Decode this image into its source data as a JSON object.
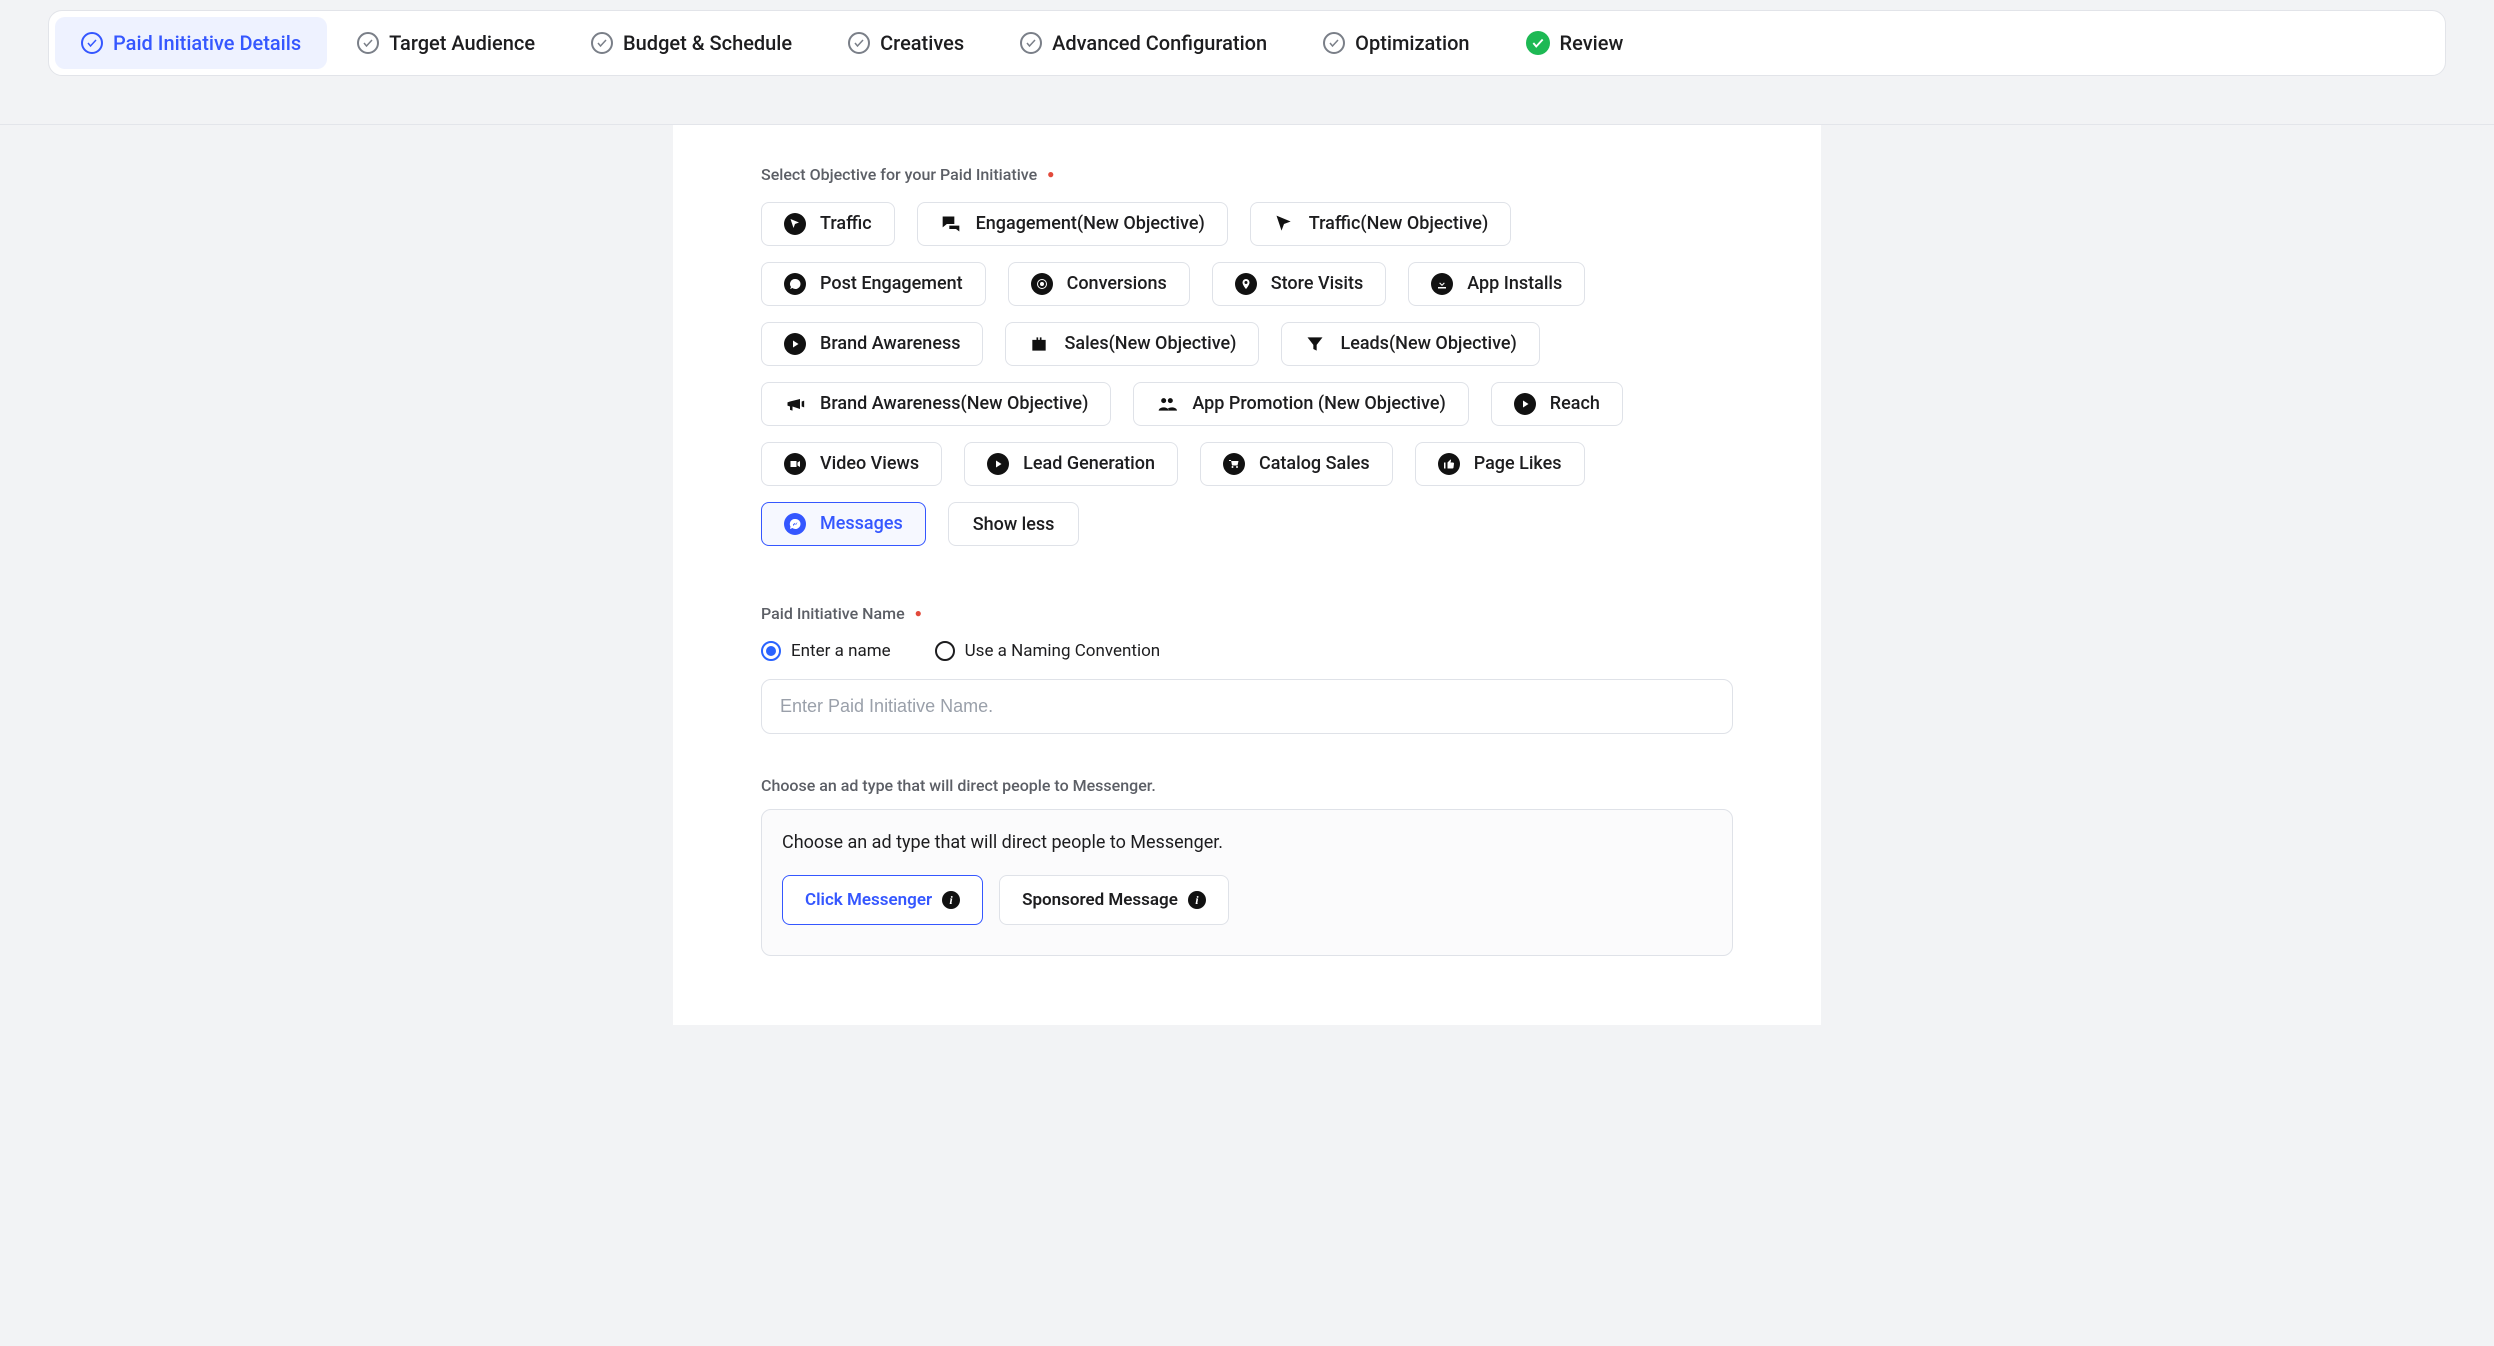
{
  "stepper": {
    "tabs": [
      {
        "label": "Paid Initiative Details",
        "state": "active"
      },
      {
        "label": "Target Audience",
        "state": "pending"
      },
      {
        "label": "Budget & Schedule",
        "state": "pending"
      },
      {
        "label": "Creatives",
        "state": "pending"
      },
      {
        "label": "Advanced Configuration",
        "state": "pending"
      },
      {
        "label": "Optimization",
        "state": "pending"
      },
      {
        "label": "Review",
        "state": "done"
      }
    ]
  },
  "objective": {
    "section_label": "Select Objective for your Paid Initiative",
    "chips": [
      {
        "label": "Traffic",
        "icon": "cursor-circle"
      },
      {
        "label": "Engagement(New Objective)",
        "icon": "chat-bare"
      },
      {
        "label": "Traffic(New Objective)",
        "icon": "cursor-bare"
      },
      {
        "label": "Post Engagement",
        "icon": "speech-circle"
      },
      {
        "label": "Conversions",
        "icon": "target-circle"
      },
      {
        "label": "Store Visits",
        "icon": "pin-circle"
      },
      {
        "label": "App Installs",
        "icon": "download-circle"
      },
      {
        "label": "Brand Awareness",
        "icon": "play-circle"
      },
      {
        "label": "Sales(New Objective)",
        "icon": "briefcase-bare"
      },
      {
        "label": "Leads(New Objective)",
        "icon": "funnel-bare"
      },
      {
        "label": "Brand Awareness(New Objective)",
        "icon": "megaphone-bare"
      },
      {
        "label": "App Promotion (New Objective)",
        "icon": "people-bare"
      },
      {
        "label": "Reach",
        "icon": "play-circle"
      },
      {
        "label": "Video Views",
        "icon": "video-circle"
      },
      {
        "label": "Lead Generation",
        "icon": "play-circle"
      },
      {
        "label": "Catalog Sales",
        "icon": "cart-circle"
      },
      {
        "label": "Page Likes",
        "icon": "like-circle"
      },
      {
        "label": "Messages",
        "icon": "messenger-circle",
        "selected": true
      }
    ],
    "show_less_label": "Show less"
  },
  "name": {
    "section_label": "Paid Initiative Name",
    "radios": [
      {
        "label": "Enter a name",
        "checked": true
      },
      {
        "label": "Use a Naming Convention",
        "checked": false
      }
    ],
    "placeholder": "Enter Paid Initiative Name.",
    "value": ""
  },
  "adtype": {
    "heading": "Choose an ad type that will direct people to Messenger.",
    "box_text": "Choose an ad type that will direct people to Messenger.",
    "options": [
      {
        "label": "Click Messenger",
        "selected": true
      },
      {
        "label": "Sponsored Message",
        "selected": false
      }
    ]
  }
}
